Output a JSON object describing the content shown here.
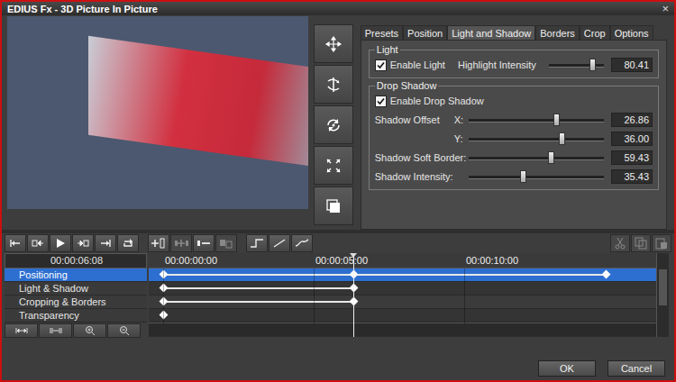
{
  "window": {
    "title": "EDIUS Fx - 3D Picture In Picture",
    "close": "×"
  },
  "tabs": [
    {
      "label": "Presets",
      "selected": false
    },
    {
      "label": "Position",
      "selected": false
    },
    {
      "label": "Light and Shadow",
      "selected": true
    },
    {
      "label": "Borders",
      "selected": false
    },
    {
      "label": "Crop",
      "selected": false
    },
    {
      "label": "Options",
      "selected": false
    }
  ],
  "light": {
    "legend": "Light",
    "enable": {
      "label": "Enable Light",
      "checked": true
    },
    "slider": {
      "label": "Highlight Intensity",
      "level": 0.78,
      "value": "80.41"
    }
  },
  "drop_shadow": {
    "legend": "Drop Shadow",
    "enable": {
      "label": "Enable Drop Shadow",
      "checked": true
    },
    "rows": [
      {
        "label": "Shadow Offset",
        "axis": "X:",
        "level": 0.65,
        "value": "26.86"
      },
      {
        "label": "",
        "axis": "Y:",
        "level": 0.69,
        "value": "36.00"
      },
      {
        "label": "Shadow Soft Border:",
        "axis": "",
        "level": 0.61,
        "value": "59.43"
      },
      {
        "label": "Shadow Intensity:",
        "axis": "",
        "level": 0.4,
        "value": "35.43"
      }
    ]
  },
  "toolbar": {
    "edit_buttons": [
      {
        "disabled": false
      },
      {
        "disabled": true
      },
      {
        "disabled": false
      },
      {
        "disabled": true
      }
    ],
    "clip_buttons": [
      {
        "disabled": true
      },
      {
        "disabled": true
      },
      {
        "disabled": true
      }
    ]
  },
  "timeline": {
    "current_time": "00:00:06:08",
    "playhead_seconds": 6.33,
    "ruler": [
      {
        "label": "00:00:00:00",
        "seconds": 0
      },
      {
        "label": "00:00:05:00",
        "seconds": 5
      },
      {
        "label": "00:00:10:00",
        "seconds": 10
      }
    ],
    "tracks": [
      {
        "name": "Positioning",
        "selected": true,
        "keyframes": [
          0,
          6.33,
          14.7
        ]
      },
      {
        "name": "Light & Shadow",
        "selected": false,
        "keyframes": [
          0,
          6.33
        ]
      },
      {
        "name": "Cropping & Borders",
        "selected": false,
        "keyframes": [
          0,
          6.33
        ]
      },
      {
        "name": "Transparency",
        "selected": false,
        "keyframes": [
          0
        ]
      }
    ]
  },
  "buttons": [
    {
      "label": "OK"
    },
    {
      "label": "Cancel"
    }
  ]
}
